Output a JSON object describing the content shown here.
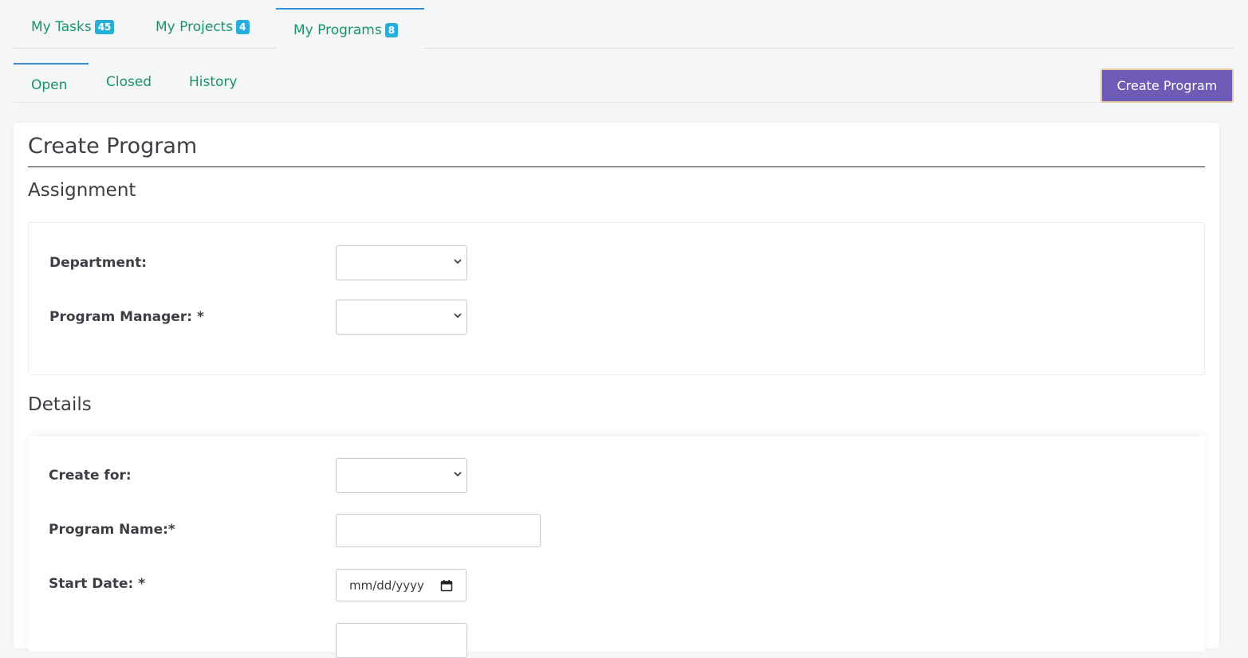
{
  "main_tabs": [
    {
      "label": "My Tasks",
      "count": "45"
    },
    {
      "label": "My Projects",
      "count": "4"
    },
    {
      "label": "My Programs",
      "count": "8",
      "active": true
    }
  ],
  "sub_tabs": [
    {
      "label": "Open",
      "active": true
    },
    {
      "label": "Closed"
    },
    {
      "label": "History"
    }
  ],
  "create_program_button": "Create Program",
  "form": {
    "title": "Create Program",
    "assignment": {
      "heading": "Assignment",
      "department_label": "Department:",
      "department_value": "",
      "program_manager_label": "Program Manager: *",
      "program_manager_value": ""
    },
    "details": {
      "heading": "Details",
      "create_for_label": "Create for:",
      "create_for_value": "",
      "program_name_label": "Program Name:*",
      "program_name_value": "",
      "start_date_label": "Start Date: *",
      "start_date_placeholder": "mm/dd/yyyy"
    }
  },
  "colors": {
    "link_green": "#16946a",
    "badge_blue": "#27aedb",
    "active_tab_border": "#3a8fd6",
    "primary_button": "#6e5bb5"
  }
}
